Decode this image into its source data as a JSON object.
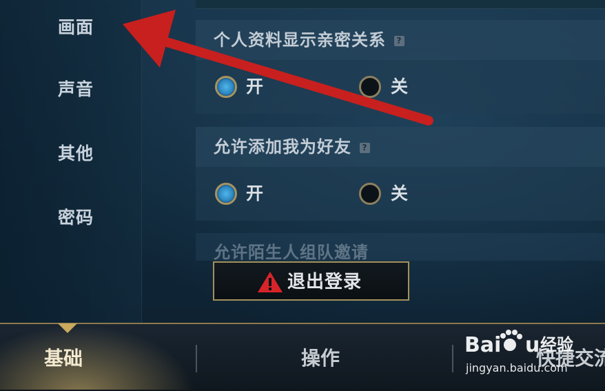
{
  "sidebar": {
    "items": [
      {
        "label": "画面"
      },
      {
        "label": "声音"
      },
      {
        "label": "其他"
      },
      {
        "label": "密码"
      }
    ]
  },
  "settings": [
    {
      "title": "个人资料显示亲密关系",
      "help_icon": "?",
      "options": [
        {
          "label": "开",
          "selected": true
        },
        {
          "label": "关",
          "selected": false
        }
      ]
    },
    {
      "title": "允许添加我为好友",
      "help_icon": "?",
      "options": [
        {
          "label": "开",
          "selected": true
        },
        {
          "label": "关",
          "selected": false
        }
      ]
    },
    {
      "title": "允许陌生人组队邀请"
    }
  ],
  "logout_button": {
    "label": "退出登录",
    "icon": "warning-icon"
  },
  "tabs": [
    {
      "label": "基础",
      "active": true
    },
    {
      "label": "操作",
      "active": false
    },
    {
      "label": "快捷交流",
      "active": false
    }
  ],
  "watermark": {
    "logo_text": "Baidu经验",
    "site": "jingyan.baidu.com"
  },
  "colors": {
    "accent_gold": "#a89460",
    "radio_on": "#3a9fd6",
    "annotation_arrow": "#c8201e",
    "warning": "#d7242a"
  }
}
